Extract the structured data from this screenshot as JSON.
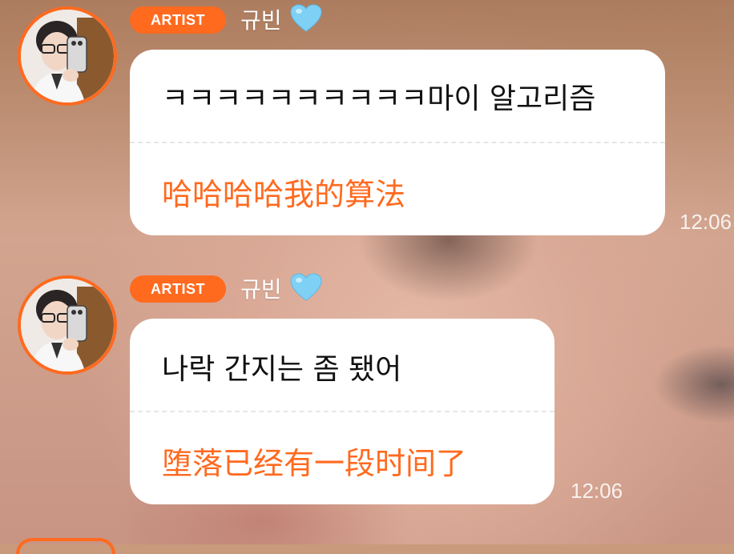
{
  "messages": [
    {
      "badge": "ARTIST",
      "name": "규빈",
      "heart_icon": "light-blue-heart",
      "original": "ㅋㅋㅋㅋㅋㅋㅋㅋㅋㅋ마이 알고리즘",
      "translation": "哈哈哈哈我的算法",
      "time": "12:06"
    },
    {
      "badge": "ARTIST",
      "name": "규빈",
      "heart_icon": "light-blue-heart",
      "original": "나락 간지는 좀 됐어",
      "translation": "堕落已经有一段时间了",
      "time": "12:06"
    }
  ],
  "colors": {
    "accent": "#ff6a1f",
    "heart": "#7fd0f5",
    "bubble": "#ffffff"
  }
}
